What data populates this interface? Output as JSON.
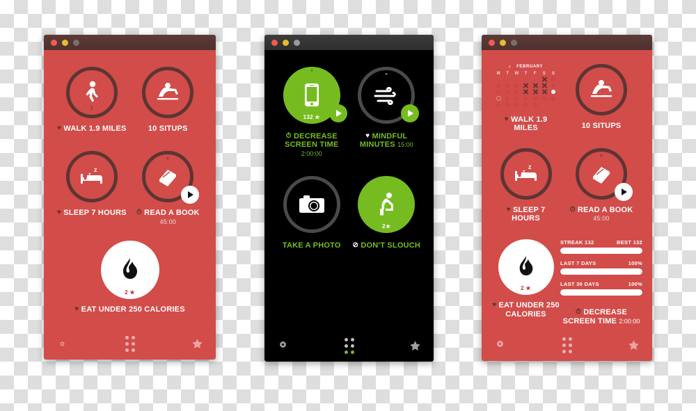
{
  "panels": [
    {
      "id": "panel-red-main",
      "theme": "red",
      "titlebar": {
        "buttons": [
          "close-button",
          "minimize-button",
          "maximize-button"
        ]
      },
      "tiles": [
        {
          "name": "walk",
          "icon": "walking-person-icon",
          "style": "ring",
          "badge": "1",
          "label": "WALK 1.9 MILES",
          "prefix": "heart",
          "timer": "",
          "play": false
        },
        {
          "name": "situps",
          "icon": "situp-person-icon",
          "style": "ring",
          "badge": "",
          "label": "10 SITUPS",
          "prefix": "none",
          "timer": "",
          "play": false
        },
        {
          "name": "sleep",
          "icon": "bed-sleep-icon",
          "style": "ring",
          "badge": "",
          "label": "SLEEP 7 HOURS",
          "prefix": "heart",
          "timer": "",
          "play": false
        },
        {
          "name": "read",
          "icon": "book-icon",
          "style": "ring",
          "badge": "",
          "label": "READ A BOOK",
          "prefix": "clock",
          "timer": "45:00",
          "play": true
        },
        {
          "name": "calories",
          "icon": "flame-icon",
          "style": "filled-white",
          "badge": "2 ★",
          "label": "EAT UNDER 250 CALORIES",
          "prefix": "heart",
          "timer": "",
          "play": false
        }
      ],
      "navbar": {
        "settings": "gear-icon",
        "apps": "grid-dots-icon",
        "favorites": "star-icon"
      }
    },
    {
      "id": "panel-dark",
      "theme": "dark",
      "titlebar": {
        "buttons": [
          "close-button",
          "minimize-button",
          "maximize-button"
        ]
      },
      "tiles": [
        {
          "name": "screen-time",
          "icon": "phone-icon",
          "style": "filled-green",
          "badge": "132 ★",
          "label": "DECREASE SCREEN TIME",
          "prefix": "clock",
          "timer": "2:00:00",
          "play": true
        },
        {
          "name": "mindful",
          "icon": "wind-icon",
          "style": "ring-grey",
          "badge": "",
          "label": "MINDFUL MINUTES",
          "prefix": "heart",
          "timer": "15:00",
          "play": true
        },
        {
          "name": "photo",
          "icon": "camera-icon",
          "style": "ring-grey",
          "badge": "",
          "label": "TAKE A PHOTO",
          "prefix": "none",
          "timer": "",
          "play": false
        },
        {
          "name": "slouch",
          "icon": "sitting-person-icon",
          "style": "filled-green",
          "badge": "2★",
          "label": "DON'T SLOUCH",
          "prefix": "no-entry",
          "timer": "",
          "play": false
        }
      ],
      "navbar": {
        "settings": "gear-icon",
        "apps": "grid-dots-icon",
        "favorites": "star-icon"
      }
    },
    {
      "id": "panel-red-stats",
      "theme": "red",
      "titlebar": {
        "buttons": [
          "close-button",
          "minimize-button",
          "maximize-button"
        ]
      },
      "calendar": {
        "month": "FEBRUARY",
        "prev_label": "‹",
        "dow": [
          "M",
          "T",
          "W",
          "T",
          "F",
          "S",
          "S"
        ],
        "weeks": [
          [
            "blank",
            "blank",
            "blank",
            "blank",
            "blank",
            "x",
            "dim"
          ],
          [
            "dim",
            "dim",
            "dim",
            "x",
            "x",
            "x",
            "dim"
          ],
          [
            "dim",
            "dim",
            "dim",
            "x",
            "x",
            "x",
            "today"
          ],
          [
            "open",
            "dim",
            "dim",
            "dim",
            "dim",
            "dim",
            "dim"
          ],
          [
            "dim",
            "dim",
            "dim",
            "dim",
            "dim",
            "blank",
            "blank"
          ]
        ]
      },
      "tiles": [
        {
          "name": "walk",
          "icon": "walking-person-icon",
          "style": "none",
          "badge": "",
          "label": "WALK 1.9 MILES",
          "prefix": "heart",
          "timer": "",
          "play": false
        },
        {
          "name": "situps",
          "icon": "situp-person-icon",
          "style": "ring",
          "badge": "",
          "label": "10 SITUPS",
          "prefix": "none",
          "timer": "",
          "play": false
        },
        {
          "name": "sleep",
          "icon": "bed-sleep-icon",
          "style": "ring",
          "badge": "",
          "label": "SLEEP 7 HOURS",
          "prefix": "heart",
          "timer": "",
          "play": false
        },
        {
          "name": "read",
          "icon": "book-icon",
          "style": "ring",
          "badge": "",
          "label": "READ A BOOK",
          "prefix": "clock",
          "timer": "45:00",
          "play": true
        },
        {
          "name": "calories",
          "icon": "flame-icon",
          "style": "filled-white",
          "badge": "2 ★",
          "label": "EAT UNDER 250 CALORIES",
          "prefix": "heart",
          "timer": "",
          "play": false
        },
        {
          "name": "screen-time",
          "icon": "none",
          "style": "none",
          "badge": "",
          "label": "DECREASE SCREEN TIME",
          "prefix": "clock",
          "timer": "2:00:00",
          "play": false
        }
      ],
      "stats": [
        {
          "left_label": "STREAK",
          "left_value": "132",
          "right_label": "BEST",
          "right_value": "132",
          "fill_pct": 100
        },
        {
          "left_label": "LAST 7 DAYS",
          "left_value": "",
          "right_label": "",
          "right_value": "100%",
          "fill_pct": 100
        },
        {
          "left_label": "LAST 30 DAYS",
          "left_value": "",
          "right_label": "",
          "right_value": "100%",
          "fill_pct": 100
        }
      ],
      "navbar": {
        "settings": "gear-icon",
        "apps": "grid-dots-icon",
        "favorites": "star-icon"
      }
    }
  ],
  "colors": {
    "red_body": "#d24c49",
    "red_titlebar": "#543431",
    "green_accent": "#76bc21",
    "dark_body": "#000000",
    "ring_dark": "#5c3533",
    "ring_grey": "#4a4a4a"
  }
}
